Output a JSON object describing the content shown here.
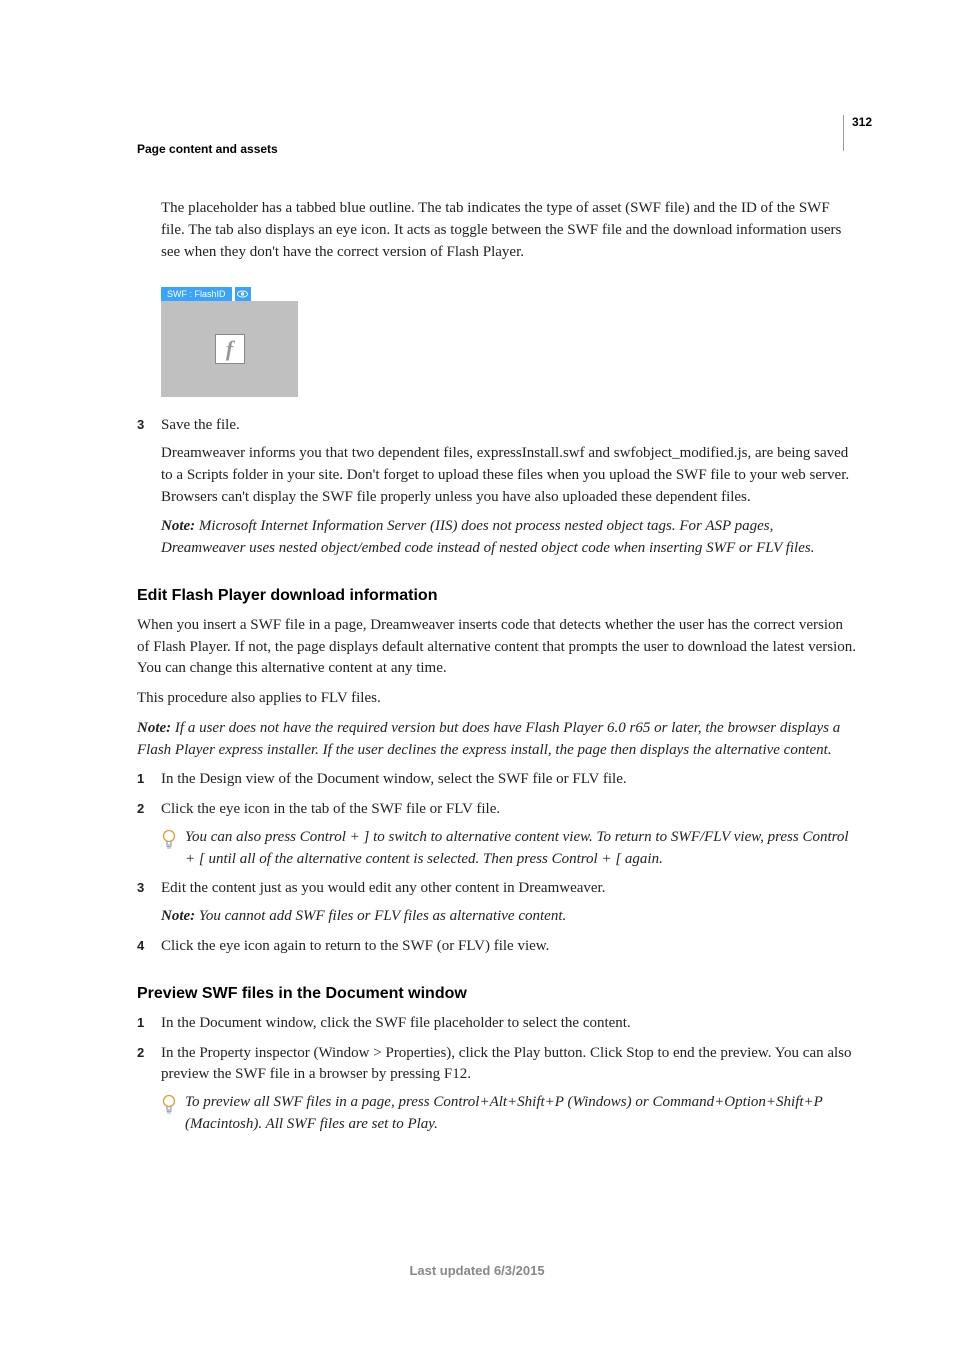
{
  "pageNumber": "312",
  "headerLabel": "Page content and assets",
  "introPara": "The placeholder has a tabbed blue outline. The tab indicates the type of asset (SWF file) and the ID of the SWF file. The tab also displays an eye icon. It acts as toggle between the SWF file and the download information users see when they don't have the correct version of Flash Player.",
  "swfTab": {
    "label": "SWF : FlashID"
  },
  "step3": {
    "num": "3",
    "text": "Save the file."
  },
  "step3para": "Dreamweaver informs you that two dependent files, expressInstall.swf and swfobject_modified.js, are being saved to a Scripts folder in your site. Don't forget to upload these files when you upload the SWF file to your web server. Browsers can't display the SWF file properly unless you have also uploaded these dependent files.",
  "step3note": {
    "label": "Note:",
    "text": " Microsoft Internet Information Server (IIS) does not process nested object tags. For ASP pages, Dreamweaver uses nested object/embed code instead of nested object code when inserting SWF or FLV files."
  },
  "editSection": {
    "heading": "Edit Flash Player download information",
    "para1": "When you insert a SWF file in a page, Dreamweaver inserts code that detects whether the user has the correct version of Flash Player. If not, the page displays default alternative content that prompts the user to download the latest version. You can change this alternative content at any time.",
    "para2": "This procedure also applies to FLV files.",
    "note": {
      "label": "Note:",
      "text": "  If a user does not have the required version but does have Flash Player 6.0 r65 or later, the browser displays a Flash Player express installer. If the user declines the express install, the page then displays the alternative content."
    },
    "steps": [
      {
        "num": "1",
        "text": "In the Design view of the Document window, select the SWF file or FLV file."
      },
      {
        "num": "2",
        "text": "Click the eye icon in the tab of the SWF file or FLV file."
      }
    ],
    "tip": "You can also press Control + ] to switch to alternative content view. To return to SWF/FLV view, press Control + [ until all of the alternative content is selected. Then press Control + [ again.",
    "step3b": {
      "num": "3",
      "text": "Edit the content just as you would edit any other content in Dreamweaver."
    },
    "note2": {
      "label": "Note:",
      "text": " You cannot add SWF files or FLV files as alternative content."
    },
    "step4": {
      "num": "4",
      "text": "Click the eye icon again to return to the SWF (or FLV) file view."
    }
  },
  "previewSection": {
    "heading": "Preview SWF files in the Document window",
    "steps": [
      {
        "num": "1",
        "text": "In the Document window, click the SWF file placeholder to select the content."
      },
      {
        "num": "2",
        "text": "In the Property inspector (Window > Properties), click the Play button. Click Stop to end the preview. You can also preview the SWF file in a browser by pressing F12."
      }
    ],
    "tip": "To preview all SWF files in a page, press Control+Alt+Shift+P (Windows) or Command+Option+Shift+P (Macintosh). All SWF files are set to Play."
  },
  "footer": "Last updated 6/3/2015"
}
